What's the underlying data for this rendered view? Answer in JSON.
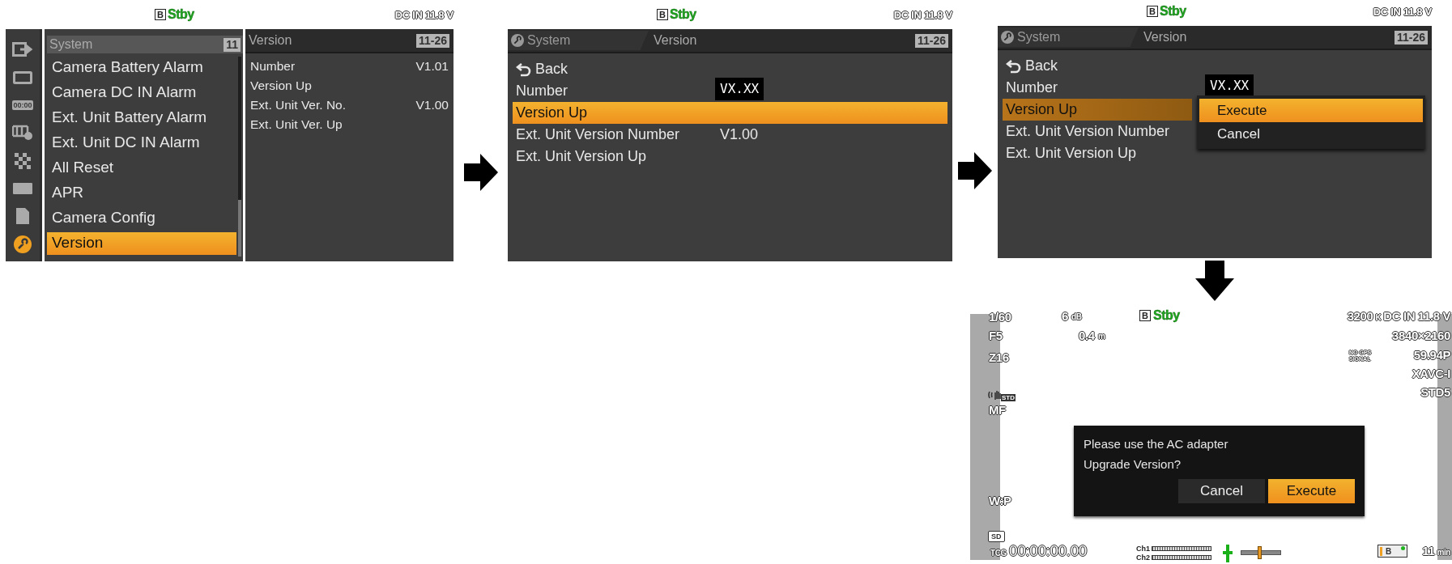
{
  "screen_1": {
    "status": {
      "badge": "B",
      "mode": "Stby",
      "power": "DC IN 11.8 V"
    },
    "sidebar": [
      {
        "kind": "exit",
        "selected": false
      },
      {
        "kind": "monitor",
        "selected": false
      },
      {
        "kind": "timecode",
        "label": "00:00",
        "selected": false
      },
      {
        "kind": "film",
        "selected": false
      },
      {
        "kind": "checker",
        "selected": false
      },
      {
        "kind": "card",
        "selected": false
      },
      {
        "kind": "file",
        "selected": false
      },
      {
        "kind": "wrench",
        "selected": true
      }
    ],
    "menu": {
      "title": "System",
      "page": "11",
      "items": [
        {
          "label": "Camera Battery Alarm",
          "selected": false
        },
        {
          "label": "Camera DC IN Alarm",
          "selected": false
        },
        {
          "label": "Ext. Unit Battery Alarm",
          "selected": false
        },
        {
          "label": "Ext. Unit DC IN Alarm",
          "selected": false
        },
        {
          "label": "All Reset",
          "selected": false
        },
        {
          "label": "APR",
          "selected": false
        },
        {
          "label": "Camera Config",
          "selected": false
        },
        {
          "label": "Version",
          "selected": true
        }
      ]
    },
    "detail": {
      "title": "Version",
      "page": "11-26",
      "rows": [
        {
          "label": "Number",
          "value": "V1.01"
        },
        {
          "label": "Version Up"
        },
        {
          "label": "Ext. Unit Ver. No.",
          "value": "V1.00"
        },
        {
          "label": "Ext. Unit Ver. Up"
        }
      ]
    }
  },
  "screen_2": {
    "status": {
      "badge": "B",
      "mode": "Stby",
      "power": "DC IN 11.8 V"
    },
    "header": {
      "parent": "System",
      "title": "Version",
      "page": "11-26"
    },
    "rows": [
      {
        "kind": "back",
        "label": "Back",
        "selected": false
      },
      {
        "kind": "item",
        "label": "Number",
        "value": "VX.XX",
        "value_boxed": true,
        "selected": false
      },
      {
        "kind": "item",
        "label": "Version Up",
        "selected": true
      },
      {
        "kind": "item",
        "label": "Ext. Unit Version Number",
        "value": "V1.00",
        "value_boxed": false,
        "selected": false
      },
      {
        "kind": "item",
        "label": "Ext. Unit Version Up",
        "selected": false
      }
    ]
  },
  "screen_3": {
    "status": {
      "badge": "B",
      "mode": "Stby",
      "power": "DC IN 11.8 V"
    },
    "header": {
      "parent": "System",
      "title": "Version",
      "page": "11-26"
    },
    "rows": [
      {
        "kind": "back",
        "label": "Back",
        "selected": false
      },
      {
        "kind": "item",
        "label": "Number",
        "value": "VX.XX",
        "value_boxed": true,
        "selected": false
      },
      {
        "kind": "item",
        "label": "Version Up",
        "selected": true
      },
      {
        "kind": "item",
        "label": "Ext. Unit Version Number",
        "selected": false
      },
      {
        "kind": "item",
        "label": "Ext. Unit Version Up",
        "selected": false
      }
    ],
    "popup": {
      "options": [
        {
          "label": "Execute",
          "selected": true
        },
        {
          "label": "Cancel",
          "selected": false
        }
      ]
    }
  },
  "viewfinder": {
    "shutter": "1/60",
    "gain": {
      "value": "6",
      "unit": "dB"
    },
    "status": {
      "badge": "B",
      "mode": "Stby"
    },
    "color_temp": {
      "value": "3200",
      "unit": "K"
    },
    "power": "DC IN 11.8 V",
    "iris": "F5",
    "focus_distance": {
      "value": "0.4",
      "unit": "m"
    },
    "resolution": "3840×2160",
    "zoom": "Z16",
    "gps": [
      "NO GPS",
      "SIGNAL"
    ],
    "frame_rate": "59.94P",
    "codec": "XAVC-I",
    "steady_shot": "STD",
    "picture_profile": "STD5",
    "focus_mode": "MF",
    "white_balance": "W:P",
    "dialog": {
      "lines": [
        "Please use the AC adapter",
        "Upgrade Version?"
      ],
      "buttons": [
        {
          "label": "Cancel",
          "selected": false
        },
        {
          "label": "Execute",
          "selected": true
        }
      ]
    },
    "media": "SD",
    "timecode": {
      "label": "TCG",
      "value": "00:00:00.00"
    },
    "audio": {
      "channels": [
        "Ch1",
        "Ch2"
      ],
      "level": 0.46
    },
    "battery": {
      "label": "B",
      "remaining": "11",
      "unit": "min"
    }
  }
}
